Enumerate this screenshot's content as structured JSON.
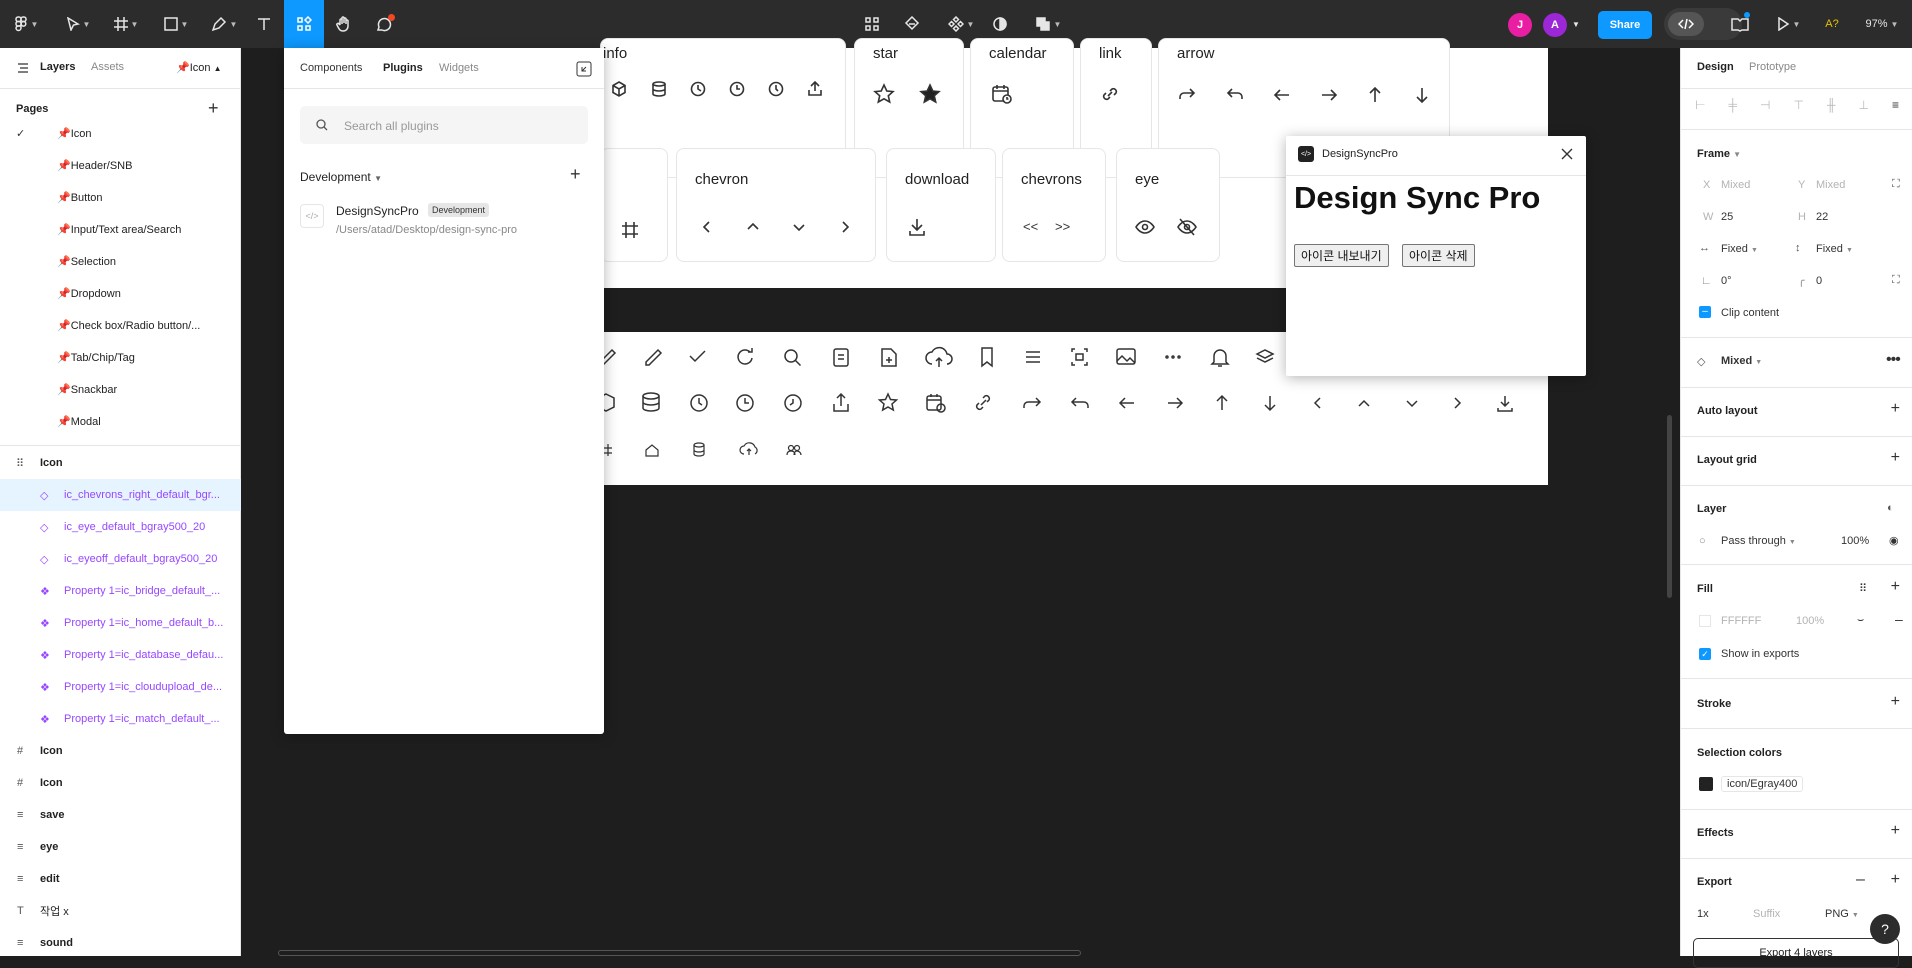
{
  "toolbar": {
    "avatars": [
      {
        "letter": "J",
        "color": "#e91ea3"
      },
      {
        "letter": "A",
        "color": "#9b27d6"
      }
    ],
    "share": "Share",
    "ai": "A?",
    "zoom": "97%"
  },
  "left": {
    "tabs": [
      "Layers",
      "Assets"
    ],
    "page_selector": "📌Icon",
    "pages_title": "Pages",
    "pages": [
      "📌Icon",
      "📌Header/SNB",
      "📌Button",
      "📌Input/Text area/Search",
      "📌Selection",
      "📌Dropdown",
      "📌Check box/Radio button/...",
      "📌Tab/Chip/Tag",
      "📌Snackbar",
      "📌Modal"
    ],
    "layer_root": "Icon",
    "layers": [
      "ic_chevrons_right_default_bgr...",
      "ic_eye_default_bgray500_20",
      "ic_eyeoff_default_bgray500_20",
      "Property 1=ic_bridge_default_...",
      "Property 1=ic_home_default_b...",
      "Property 1=ic_database_defau...",
      "Property 1=ic_cloudupload_de...",
      "Property 1=ic_match_default_..."
    ],
    "bottom_layers": [
      "Icon",
      "Icon",
      "save",
      "eye",
      "edit",
      "작업 x",
      "sound"
    ]
  },
  "plugins": {
    "tabs": [
      "Components",
      "Plugins",
      "Widgets"
    ],
    "search_placeholder": "Search all plugins",
    "section": "Development",
    "item": {
      "name": "DesignSyncPro",
      "badge": "Development",
      "path": "/Users/atad/Desktop/design-sync-pro"
    }
  },
  "canvas": {
    "groups_top": [
      "info",
      "star",
      "calendar",
      "link",
      "arrow"
    ],
    "groups_mid": [
      "chevron",
      "download",
      "chevrons",
      "eye"
    ],
    "chevrons_text": [
      "<<",
      ">>"
    ]
  },
  "dsp": {
    "window_title": "DesignSyncPro",
    "heading": "Design Sync Pro",
    "export_btn": "아이콘 내보내기",
    "delete_btn": "아이콘 삭제"
  },
  "right": {
    "tabs": [
      "Design",
      "Prototype"
    ],
    "frame": "Frame",
    "x": "X",
    "x_val": "Mixed",
    "y": "Y",
    "y_val": "Mixed",
    "w": "W",
    "w_val": "25",
    "h": "H",
    "h_val": "22",
    "wfix": "Fixed",
    "hfix": "Fixed",
    "rot": "0°",
    "radius": "0",
    "clip": "Clip content",
    "mixed": "Mixed",
    "auto_layout": "Auto layout",
    "layout_grid": "Layout grid",
    "layer": "Layer",
    "blend": "Pass through",
    "opacity": "100%",
    "fill": "Fill",
    "fill_hex": "FFFFFF",
    "fill_opacity": "100%",
    "show_exports": "Show in exports",
    "stroke": "Stroke",
    "selection_colors": "Selection colors",
    "sel_color_name": "icon/Egray400",
    "effects": "Effects",
    "export": "Export",
    "scale": "1x",
    "suffix": "Suffix",
    "format": "PNG",
    "export_btn": "Export 4 layers"
  },
  "help": "?"
}
